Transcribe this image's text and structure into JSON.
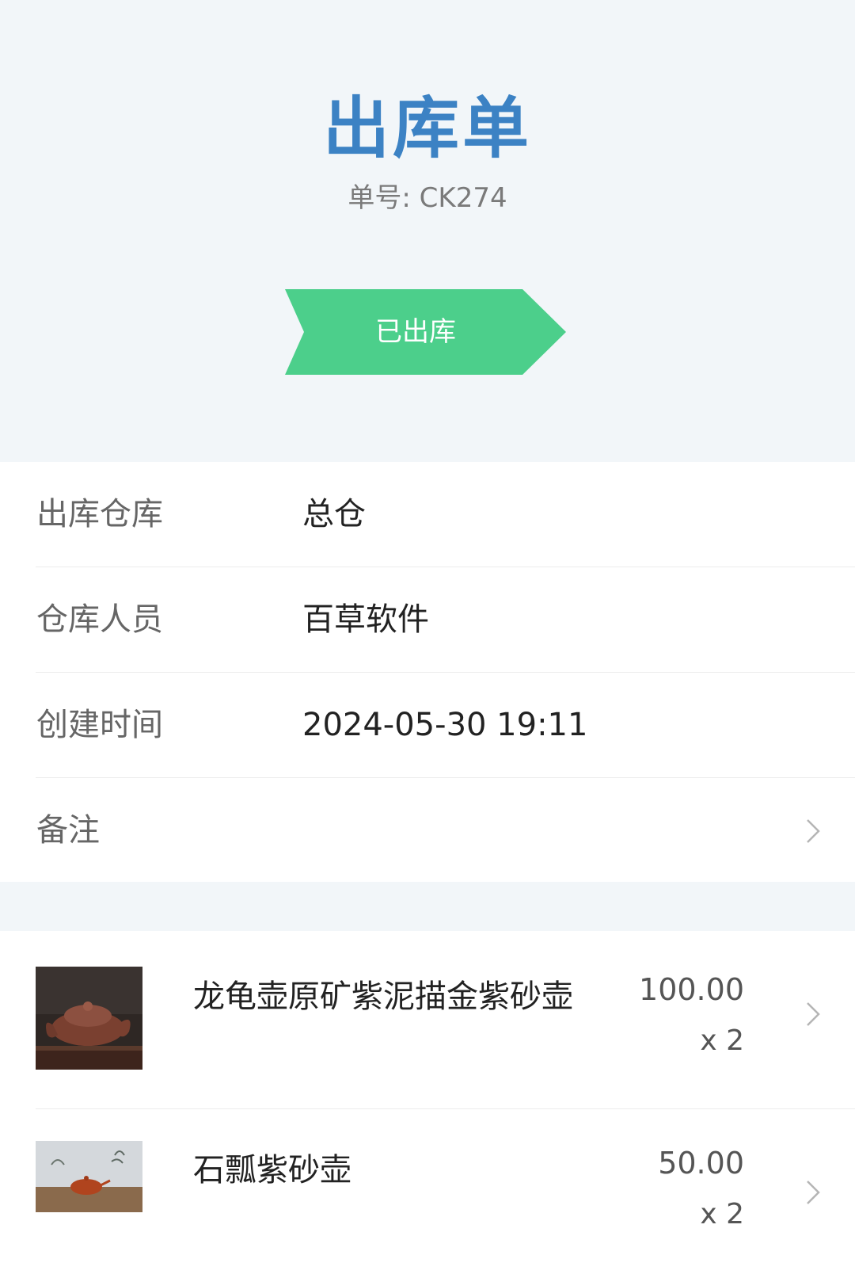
{
  "header": {
    "title": "出库单",
    "order_number": "单号: CK274",
    "status": "已出库",
    "status_color": "#4ccf8b",
    "title_color": "#3c82c4"
  },
  "info": {
    "rows": [
      {
        "label": "出库仓库",
        "value": "总仓"
      },
      {
        "label": "仓库人员",
        "value": "百草软件"
      },
      {
        "label": "创建时间",
        "value": "2024-05-30 19:11"
      },
      {
        "label": "备注",
        "value": ""
      }
    ]
  },
  "items": [
    {
      "name": "龙龟壶原矿紫泥描金紫砂壶",
      "price": "100.00",
      "quantity": "x 2",
      "thumbnail": "dragon-turtle-teapot"
    },
    {
      "name": "石瓢紫砂壶",
      "price": "50.00",
      "quantity": "x 2",
      "thumbnail": "shipiao-teapot"
    }
  ],
  "icons": {
    "row_chevron": "chevron-right-icon"
  }
}
